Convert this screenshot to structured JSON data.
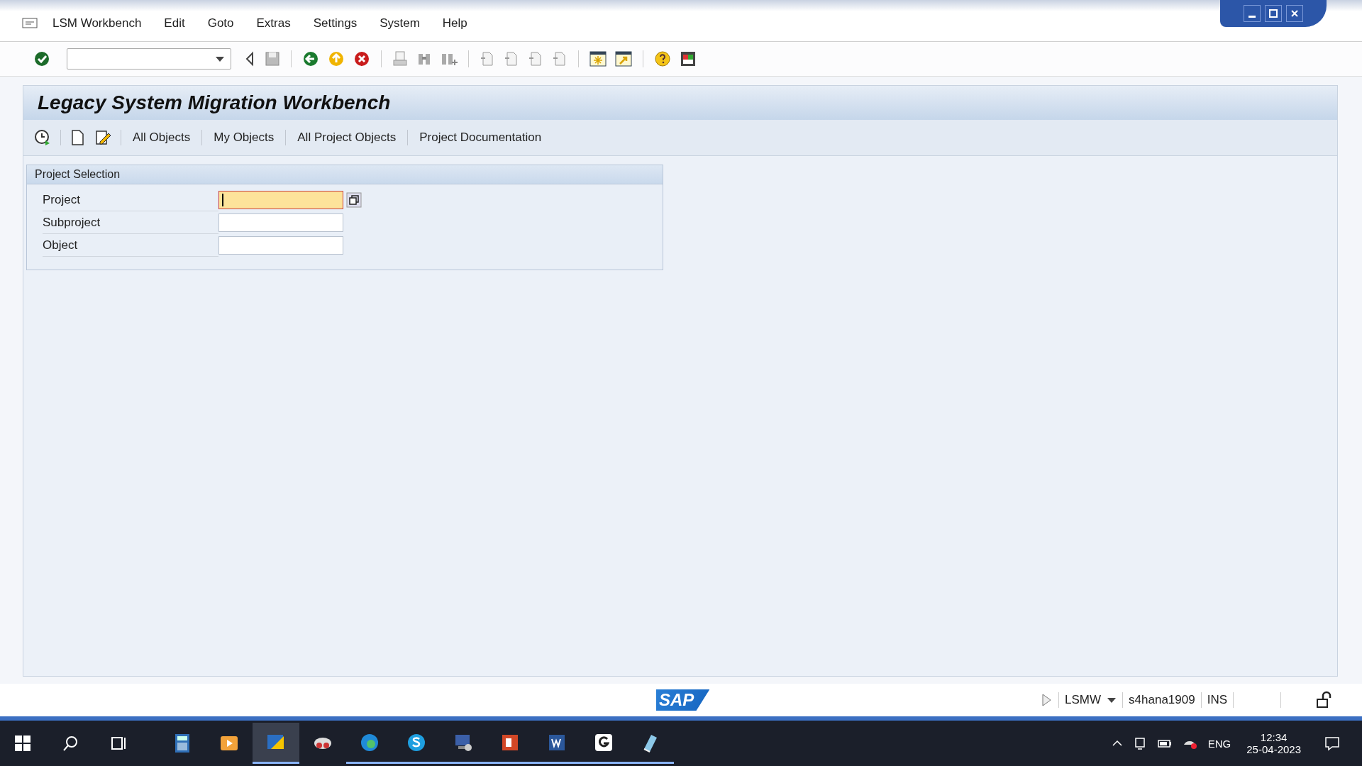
{
  "menu": [
    {
      "label": "LSM Workbench"
    },
    {
      "label": "Edit"
    },
    {
      "label": "Goto"
    },
    {
      "label": "Extras"
    },
    {
      "label": "Settings"
    },
    {
      "label": "System"
    },
    {
      "label": "Help"
    }
  ],
  "title": "Legacy System Migration Workbench",
  "app_toolbar": [
    {
      "label": "All Objects"
    },
    {
      "label": "My Objects"
    },
    {
      "label": "All Project Objects"
    },
    {
      "label": "Project Documentation"
    }
  ],
  "group": {
    "title": "Project Selection",
    "fields": [
      {
        "label": "Project",
        "focused": true
      },
      {
        "label": "Subproject",
        "focused": false
      },
      {
        "label": "Object",
        "focused": false
      }
    ]
  },
  "status_bar": {
    "logo": "SAP",
    "transaction": "LSMW",
    "system": "s4hana1909",
    "mode": "INS"
  },
  "taskbar": {
    "apps": [
      {
        "kind": "calculator",
        "selected": false,
        "running": false
      },
      {
        "kind": "player",
        "selected": false,
        "running": false
      },
      {
        "kind": "sap",
        "selected": true,
        "running": true
      },
      {
        "kind": "snip",
        "selected": false,
        "running": false
      },
      {
        "kind": "edge",
        "selected": false,
        "running": true
      },
      {
        "kind": "skype",
        "selected": false,
        "running": true
      },
      {
        "kind": "remote",
        "selected": false,
        "running": true
      },
      {
        "kind": "powerpoint",
        "selected": false,
        "running": true
      },
      {
        "kind": "word",
        "selected": false,
        "running": true
      },
      {
        "kind": "g",
        "selected": false,
        "running": true
      },
      {
        "kind": "notes",
        "selected": false,
        "running": true
      }
    ],
    "language": "ENG",
    "time": "12:34",
    "date": "25-04-2023"
  }
}
